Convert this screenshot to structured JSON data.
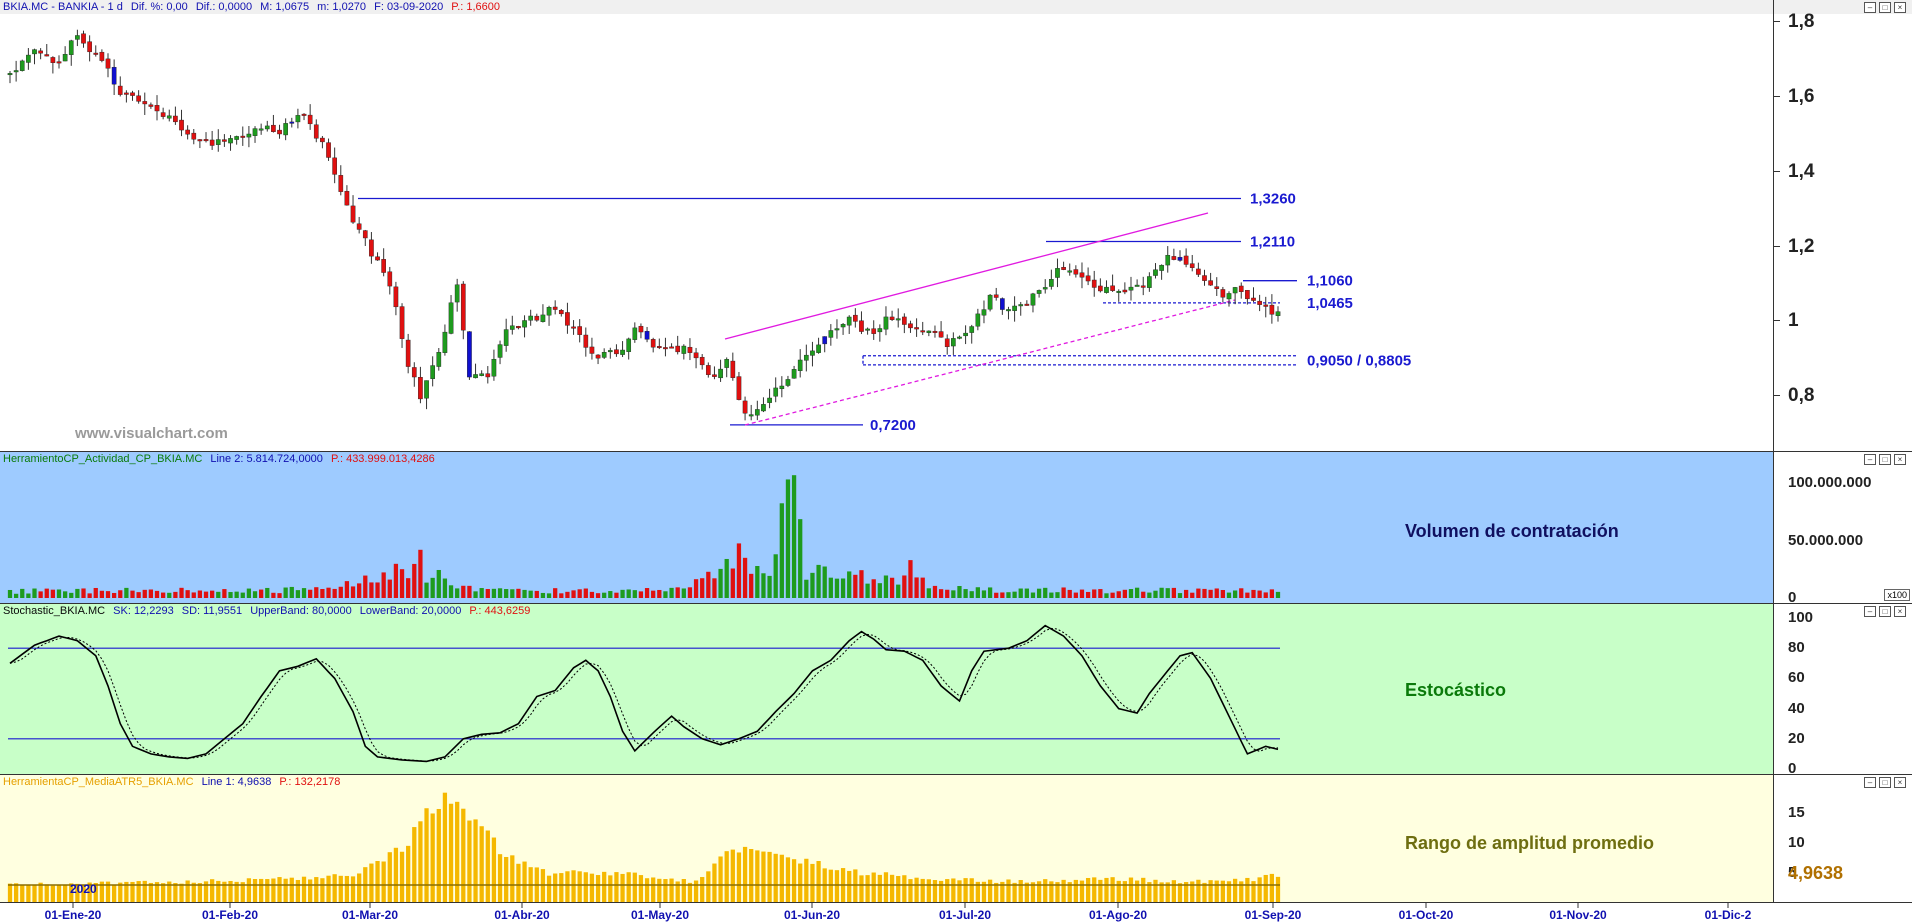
{
  "price_panel": {
    "header": [
      "BKIA.MC - BANKIA - 1 d",
      "Dif. %: 0,00",
      "Dif.: 0,0000",
      "M: 1,0675",
      "m: 1,0270",
      "F: 03-09-2020"
    ],
    "header_p": "P.: 1,6600",
    "watermark": "www.visualchart.com",
    "levels": [
      {
        "label": "1,3260",
        "value": 1.326,
        "style": "solid"
      },
      {
        "label": "1,2110",
        "value": 1.211,
        "style": "solid"
      },
      {
        "label": "1,1060",
        "value": 1.106,
        "style": "solid"
      },
      {
        "label": "1,0465",
        "value": 1.0465,
        "style": "dashed"
      },
      {
        "label": "0,9050 / 0,8805",
        "value": 0.905,
        "value2": 0.8805,
        "style": "dashed"
      },
      {
        "label": "0,7200",
        "value": 0.72,
        "style": "solid"
      }
    ],
    "y_ticks": [
      {
        "v": 1.8,
        "label": "1,8"
      },
      {
        "v": 1.6,
        "label": "1,6"
      },
      {
        "v": 1.4,
        "label": "1,4"
      },
      {
        "v": 1.2,
        "label": "1,2"
      },
      {
        "v": 1.0,
        "label": "1"
      },
      {
        "v": 0.8,
        "label": "0,8"
      }
    ]
  },
  "volume_panel": {
    "header": "HerramientoCP_Actividad_CP_BKIA.MC",
    "header_line": "Line 2: 5.814.724,0000",
    "header_p": "P.: 433.999.013,4286",
    "title": "Volumen de contratación",
    "y_ticks": [
      {
        "v": 100000000,
        "label": "100.000.000"
      },
      {
        "v": 50000000,
        "label": "50.000.000"
      },
      {
        "v": 0,
        "label": "0"
      }
    ],
    "multiplier": "x100"
  },
  "stoch_panel": {
    "header": "Stochastic_BKIA.MC",
    "header_values": [
      "SK: 12,2293",
      "SD: 11,9551",
      "UpperBand: 80,0000",
      "LowerBand: 20,0000"
    ],
    "header_p": "P.: 443,6259",
    "title": "Estocástico",
    "y_ticks": [
      {
        "v": 100,
        "label": "100"
      },
      {
        "v": 80,
        "label": "80"
      },
      {
        "v": 60,
        "label": "60"
      },
      {
        "v": 40,
        "label": "40"
      },
      {
        "v": 20,
        "label": "20"
      },
      {
        "v": 0,
        "label": "0"
      }
    ]
  },
  "atr_panel": {
    "header": "HerramientaCP_MediaATR5_BKIA.MC",
    "header_line": "Line 1: 4,9638",
    "header_p": "P.: 132,2178",
    "title": "Rango de amplitud promedio",
    "last_value": "4,9638",
    "y_ticks": [
      {
        "v": 15,
        "label": "15"
      },
      {
        "v": 10,
        "label": "10"
      },
      {
        "v": 5,
        "label": "5"
      }
    ]
  },
  "x_axis": {
    "year_label": "2020",
    "ticks": [
      "01-Ene-20",
      "01-Feb-20",
      "01-Mar-20",
      "01-Abr-20",
      "01-May-20",
      "01-Jun-20",
      "01-Jul-20",
      "01-Ago-20",
      "01-Sep-20",
      "01-Oct-20",
      "01-Nov-20",
      "01-Dic-2"
    ]
  },
  "colors": {
    "up": "#1e9b1e",
    "down": "#e01010",
    "reversal": "#1010d0",
    "level_line": "#1a1ad0",
    "trend": "#e01ae0",
    "volume_bg": "#9ecbff",
    "stoch_bg": "#c8ffc8",
    "atr_bg": "#ffffe0",
    "atr_bar": "#f5b800",
    "stoch_k": "#000000"
  },
  "chart_data": [
    {
      "type": "candlestick",
      "series": [
        {
          "name": "BKIA.MC - BANKIA",
          "anchors_close": [
            [
              0,
              1.66
            ],
            [
              4,
              1.72
            ],
            [
              8,
              1.69
            ],
            [
              11,
              1.76
            ],
            [
              15,
              1.7
            ],
            [
              18,
              1.61
            ],
            [
              22,
              1.59
            ],
            [
              27,
              1.53
            ],
            [
              31,
              1.47
            ],
            [
              35,
              1.48
            ],
            [
              39,
              1.51
            ],
            [
              44,
              1.51
            ],
            [
              48,
              1.55
            ],
            [
              51,
              1.47
            ],
            [
              53,
              1.4
            ],
            [
              56,
              1.27
            ],
            [
              59,
              1.18
            ],
            [
              62,
              1.1
            ],
            [
              65,
              0.88
            ],
            [
              67,
              0.8
            ],
            [
              70,
              0.92
            ],
            [
              73,
              1.1
            ],
            [
              75,
              0.86
            ],
            [
              78,
              0.85
            ],
            [
              81,
              0.97
            ],
            [
              85,
              1.0
            ],
            [
              89,
              1.03
            ],
            [
              92,
              0.97
            ],
            [
              95,
              0.91
            ],
            [
              99,
              0.91
            ],
            [
              102,
              0.97
            ],
            [
              105,
              0.93
            ],
            [
              110,
              0.92
            ],
            [
              113,
              0.88
            ],
            [
              115,
              0.84
            ],
            [
              117,
              0.9
            ],
            [
              119,
              0.78
            ],
            [
              121,
              0.74
            ],
            [
              124,
              0.8
            ],
            [
              127,
              0.85
            ],
            [
              130,
              0.9
            ],
            [
              134,
              0.98
            ],
            [
              137,
              1.0
            ],
            [
              141,
              0.96
            ],
            [
              143,
              1.01
            ],
            [
              147,
              0.98
            ],
            [
              150,
              0.97
            ],
            [
              153,
              0.93
            ],
            [
              157,
              0.99
            ],
            [
              160,
              1.06
            ],
            [
              163,
              1.03
            ],
            [
              166,
              1.05
            ],
            [
              169,
              1.08
            ],
            [
              171,
              1.14
            ],
            [
              174,
              1.12
            ],
            [
              177,
              1.09
            ],
            [
              180,
              1.07
            ],
            [
              183,
              1.08
            ],
            [
              186,
              1.11
            ],
            [
              189,
              1.17
            ],
            [
              192,
              1.15
            ],
            [
              195,
              1.1
            ],
            [
              198,
              1.07
            ],
            [
              201,
              1.08
            ],
            [
              204,
              1.04
            ],
            [
              207,
              1.02
            ]
          ]
        }
      ],
      "n_days": 208,
      "ylim": [
        0.65,
        1.82
      ]
    },
    {
      "type": "bar",
      "series": [
        {
          "name": "HerramientoCP_Actividad_CP_BKIA.MC",
          "anchors": [
            [
              0,
              6
            ],
            [
              50,
              7
            ],
            [
              57,
              15
            ],
            [
              63,
              22
            ],
            [
              67,
              24
            ],
            [
              74,
              10
            ],
            [
              86,
              6
            ],
            [
              110,
              7
            ],
            [
              119,
              35
            ],
            [
              124,
              18
            ],
            [
              128,
              107
            ],
            [
              130,
              22
            ],
            [
              136,
              18
            ],
            [
              145,
              16
            ],
            [
              147,
              33
            ],
            [
              150,
              8
            ],
            [
              166,
              7
            ],
            [
              208,
              6
            ]
          ]
        }
      ],
      "unit": "millions",
      "ylim": [
        0,
        115000000
      ]
    },
    {
      "type": "line",
      "series": [
        {
          "name": "SK",
          "anchors": [
            [
              0,
              70
            ],
            [
              4,
              82
            ],
            [
              8,
              88
            ],
            [
              11,
              85
            ],
            [
              14,
              75
            ],
            [
              16,
              55
            ],
            [
              18,
              30
            ],
            [
              20,
              15
            ],
            [
              23,
              10
            ],
            [
              26,
              8
            ],
            [
              29,
              7
            ],
            [
              32,
              10
            ],
            [
              35,
              20
            ],
            [
              38,
              30
            ],
            [
              41,
              48
            ],
            [
              44,
              65
            ],
            [
              47,
              68
            ],
            [
              50,
              73
            ],
            [
              53,
              60
            ],
            [
              56,
              38
            ],
            [
              58,
              15
            ],
            [
              60,
              8
            ],
            [
              64,
              6
            ],
            [
              68,
              5
            ],
            [
              71,
              8
            ],
            [
              74,
              20
            ],
            [
              77,
              23
            ],
            [
              80,
              24
            ],
            [
              83,
              30
            ],
            [
              86,
              48
            ],
            [
              89,
              52
            ],
            [
              92,
              67
            ],
            [
              94,
              72
            ],
            [
              96,
              65
            ],
            [
              98,
              48
            ],
            [
              100,
              25
            ],
            [
              102,
              12
            ],
            [
              105,
              24
            ],
            [
              108,
              35
            ],
            [
              110,
              28
            ],
            [
              113,
              20
            ],
            [
              116,
              16
            ],
            [
              119,
              20
            ],
            [
              122,
              25
            ],
            [
              125,
              38
            ],
            [
              128,
              50
            ],
            [
              131,
              65
            ],
            [
              134,
              72
            ],
            [
              137,
              85
            ],
            [
              139,
              91
            ],
            [
              141,
              86
            ],
            [
              143,
              79
            ],
            [
              146,
              78
            ],
            [
              149,
              72
            ],
            [
              152,
              55
            ],
            [
              155,
              45
            ],
            [
              157,
              65
            ],
            [
              159,
              78
            ],
            [
              163,
              80
            ],
            [
              166,
              85
            ],
            [
              169,
              95
            ],
            [
              172,
              88
            ],
            [
              175,
              75
            ],
            [
              178,
              55
            ],
            [
              181,
              40
            ],
            [
              184,
              37
            ],
            [
              186,
              50
            ],
            [
              189,
              65
            ],
            [
              191,
              75
            ],
            [
              193,
              77
            ],
            [
              196,
              60
            ],
            [
              199,
              35
            ],
            [
              202,
              10
            ],
            [
              205,
              15
            ],
            [
              208,
              12
            ]
          ]
        }
      ],
      "bands": [
        80,
        20
      ],
      "ylim": [
        0,
        100
      ]
    },
    {
      "type": "bar",
      "series": [
        {
          "name": "HerramientaCP_MediaATR5_BKIA.MC",
          "anchors": [
            [
              0,
              3
            ],
            [
              30,
              3.5
            ],
            [
              55,
              4.5
            ],
            [
              60,
              6.5
            ],
            [
              64,
              9
            ],
            [
              68,
              15
            ],
            [
              72,
              18
            ],
            [
              76,
              13
            ],
            [
              80,
              9
            ],
            [
              84,
              6.5
            ],
            [
              88,
              5
            ],
            [
              95,
              5
            ],
            [
              105,
              4.5
            ],
            [
              112,
              3.5
            ],
            [
              118,
              9
            ],
            [
              121,
              9.5
            ],
            [
              125,
              8
            ],
            [
              130,
              7
            ],
            [
              135,
              5.5
            ],
            [
              140,
              5
            ],
            [
              150,
              4
            ],
            [
              165,
              3.5
            ],
            [
              180,
              4
            ],
            [
              195,
              3.5
            ],
            [
              204,
              4
            ],
            [
              208,
              5
            ]
          ]
        }
      ],
      "ylim": [
        0,
        19
      ]
    }
  ]
}
